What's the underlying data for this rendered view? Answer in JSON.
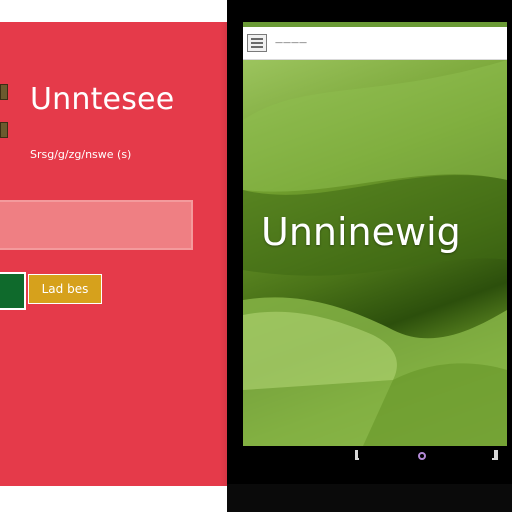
{
  "left_panel": {
    "title": "Unntesee",
    "subtitle": "Srsg/g/zg/nswe (s)",
    "input_value": "",
    "button_label": "Lad bes",
    "icons": [
      "app-icon",
      "app-icon"
    ]
  },
  "device": {
    "titlebar_text": "————",
    "wallpaper_text": "Unninewig",
    "hardware_buttons": [
      "back-button",
      "home-button",
      "search-button"
    ]
  },
  "colors": {
    "left_panel_bg": "#e53a4a",
    "input_bg": "#ef7f83",
    "button_bg": "#d6a11c",
    "checkbox_bg": "#0f6a2c",
    "device_frame": "#000000",
    "wallpaper_green": "#6f9d2d"
  }
}
